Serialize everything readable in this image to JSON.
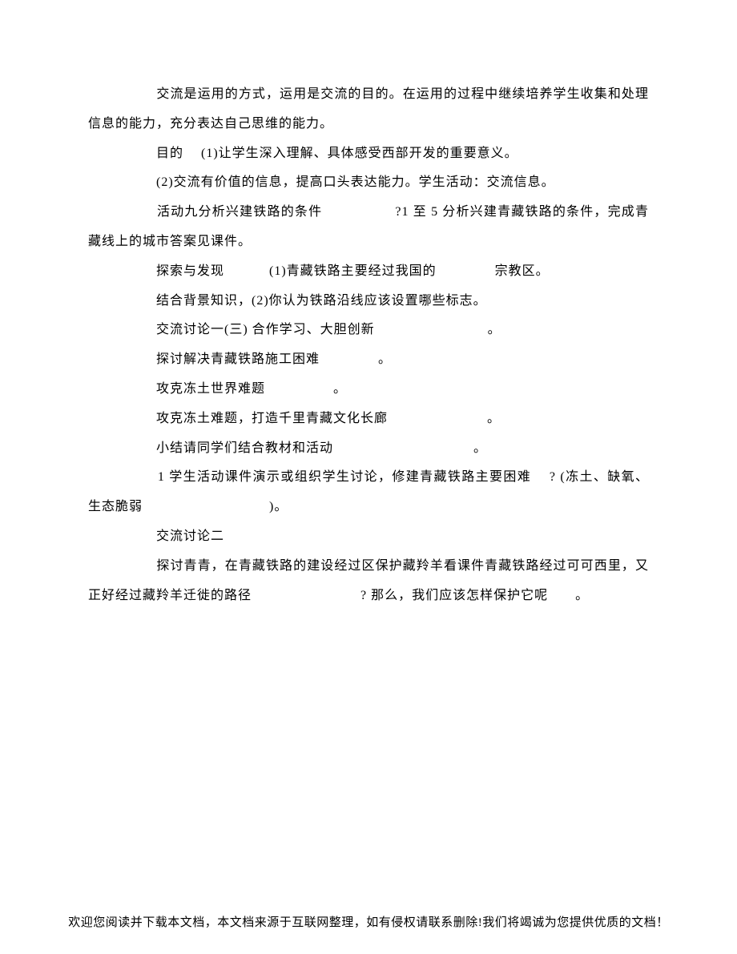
{
  "body": {
    "p1": "　　　　　交流是运用的方式，运用是交流的目的。在运用的过程中继续培养学生收集和处理信息的能力，充分表达自己思维的能力。",
    "p2": "　　　　　目的　 (1)让学生深入理解、具体感受西部开发的重要意义。",
    "p3": "　　　　　(2)交流有价值的信息，提高口头表达能力。学生活动：交流信息。",
    "p4": "　　　　　活动九分析兴建铁路的条件　　　　　 ?1 至 5 分析兴建青藏铁路的条件，完成青藏线上的城市答案见课件。",
    "p5": "　　　　　探索与发现　　　 (1)青藏铁路主要经过我国的　　　　 宗教区。",
    "p6": "　　　　　结合背景知识，(2)你认为铁路沿线应该设置哪些标志。",
    "p7": "　　　　　交流讨论一(三) 合作学习、大胆创新 　　　　　　　　。",
    "p8": "　　　　　探讨解决青藏铁路施工困难 　　　　。",
    "p9": "　　　　　攻克冻土世界难题　　　　　。",
    "p10": "　　　　　攻克冻土难题，打造千里青藏文化长廊 　　　　　　　。",
    "p11": "　　　　　小结请同学们结合教材和活动 　　　　　　　　　　。",
    "p12": "　　　　　1 学生活动课件演示或组织学生讨论，修建青藏铁路主要困难　 ? (冻土、缺氧、生态脆弱 　　　　　　　　　)。",
    "p13": "　　　　　交流讨论二",
    "p14": "　　　　　探讨青青，在青藏铁路的建设经过区保护藏羚羊看课件青藏铁路经过可可西里，又正好经过藏羚羊迁徙的路径　　　　　　　　? 那么，我们应该怎样保护它呢　　。"
  },
  "footer": {
    "text": "欢迎您阅读并下载本文档，本文档来源于互联网整理，如有侵权请联系删除!我们将竭诚为您提供优质的文档！"
  }
}
